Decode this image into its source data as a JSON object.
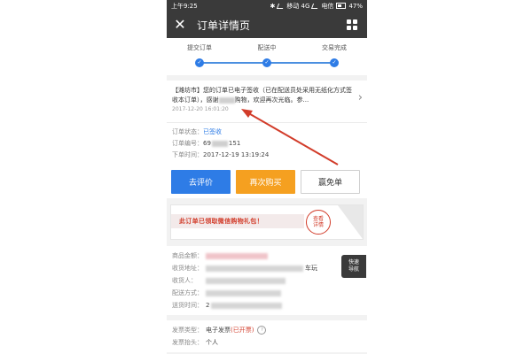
{
  "status_bar": {
    "time": "上午9:25",
    "carrier1": "移动 4G",
    "carrier2": "电信",
    "battery": "47%"
  },
  "header": {
    "title": "订单详情页",
    "close_icon": "close-icon",
    "menu_icon": "grid-icon"
  },
  "progress": {
    "steps": [
      "提交订单",
      "配送中",
      "交易完成"
    ],
    "check": "✓"
  },
  "message": {
    "text_a": "【潍坊市】您的订单已电子签收（已在配送员处采用无纸化方式签收本订单），感谢",
    "text_b": "购物，欢迎再次光临。参...",
    "time": "2017-12-20 16:01:20"
  },
  "order_info": {
    "status_label": "订单状态：",
    "status_value": "已签收",
    "number_label": "订单编号：",
    "number_prefix": "69",
    "number_suffix": "151",
    "time_label": "下单时间：",
    "time_value": "2017-12-19 13:19:24"
  },
  "buttons": {
    "review": "去评价",
    "rebuy": "再次购买",
    "free": "赢免单"
  },
  "banner": {
    "text": "此订单已领取微信购物礼包！",
    "stamp_line1": "查看",
    "stamp_line2": "详情"
  },
  "details": {
    "amount_label": "商品金额：",
    "address_label": "收货地址：",
    "address_tail": "车玩",
    "receiver_label": "收货人：",
    "delivery_label": "配送方式：",
    "delivery_time_label": "送货时间：",
    "delivery_time_prefix": "2"
  },
  "float_nav": {
    "line1": "快速",
    "line2": "导航"
  },
  "invoice": {
    "type_label": "发票类型：",
    "type_value": "电子发票",
    "type_status": "(已开票)",
    "head_label": "发票抬头：",
    "head_value": "个人"
  },
  "colors": {
    "header_bg": "#3a3a3a",
    "accent_blue": "#2e7ce6",
    "accent_orange": "#f5a020",
    "accent_red": "#d23c2a"
  }
}
